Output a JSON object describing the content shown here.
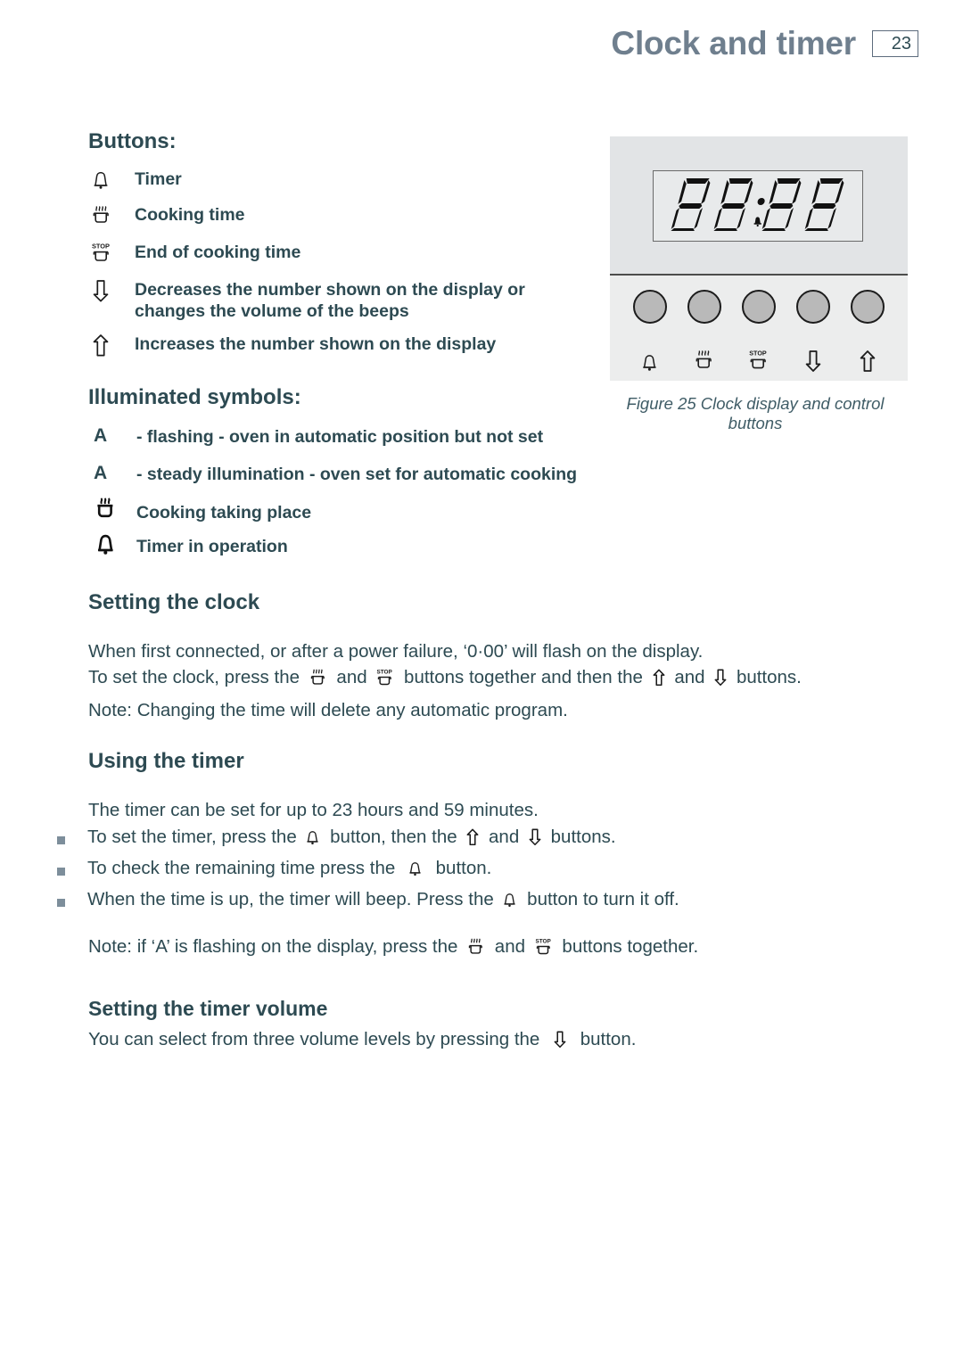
{
  "header": {
    "title": "Clock and timer",
    "page_number": "23"
  },
  "buttons_section": {
    "heading": "Buttons:",
    "items": [
      {
        "icon": "bell-icon",
        "label": "Timer"
      },
      {
        "icon": "pot-steam-icon",
        "label": "Cooking time"
      },
      {
        "icon": "pot-stop-icon",
        "label": "End of cooking time"
      },
      {
        "icon": "arrow-down-icon",
        "label": "Decreases the number shown on the display or changes the volume of the beeps"
      },
      {
        "icon": "arrow-up-icon",
        "label": "Increases the number shown on the display"
      }
    ]
  },
  "illuminated_section": {
    "heading": "Illuminated symbols:",
    "items": [
      {
        "icon": "letter-a",
        "symbol_text": "A",
        "label": "- flashing - oven in automatic position but not set"
      },
      {
        "icon": "letter-a",
        "symbol_text": "A",
        "label": "- steady illumination - oven set for automatic cooking"
      },
      {
        "icon": "pot-steam-solid-icon",
        "symbol_text": "",
        "label": "Cooking taking place"
      },
      {
        "icon": "bell-solid-icon",
        "symbol_text": "",
        "label": "Timer in operation"
      }
    ]
  },
  "figure": {
    "caption": "Figure 25 Clock display and control buttons",
    "display_value": "88:88",
    "display_separator": "dot",
    "display_indicator_icon": "bell-indicator-icon",
    "knob_count": 5,
    "knob_icons": [
      "bell-icon",
      "pot-steam-icon",
      "pot-stop-icon",
      "arrow-down-icon",
      "arrow-up-icon"
    ],
    "panel_top_color": "#e2e4e6",
    "panel_bottom_color": "#eceded",
    "knob_color": "#b9b9b9"
  },
  "clock_section": {
    "heading": "Setting the clock",
    "line1": "When first connected, or after a power failure, ‘0·00’ will flash on the display.",
    "line2_a": "To set the clock, press the",
    "line2_b": "and",
    "line2_c": "buttons together and then the",
    "line2_d": "and",
    "line2_e": "buttons.",
    "line3": "Note: Changing the time will delete any automatic program."
  },
  "timer_section": {
    "heading": "Using the timer",
    "intro": "The timer can be set for up to 23 hours and 59 minutes.",
    "bullets": [
      {
        "a": "To set the timer, press the",
        "b": "button, then the",
        "c": "and",
        "d": "buttons."
      },
      {
        "a": "To check the remaining time press the",
        "b": "button.",
        "c": "",
        "d": ""
      },
      {
        "a": "When the time is up, the timer will beep. Press the",
        "b": "button to turn it off.",
        "c": "",
        "d": ""
      }
    ]
  },
  "note_flashing": {
    "a": "Note: if ‘A’ is flashing on the display, press the",
    "b": "and",
    "c": "buttons together."
  },
  "volume_section": {
    "heading": "Setting the timer volume",
    "line_a": "You can select from three volume levels by pressing the",
    "line_b": "button."
  },
  "colors": {
    "title": "#6f7f8e",
    "body": "#2d4a52",
    "caption": "#3f5c66",
    "bullet": "#7d8e9b"
  }
}
